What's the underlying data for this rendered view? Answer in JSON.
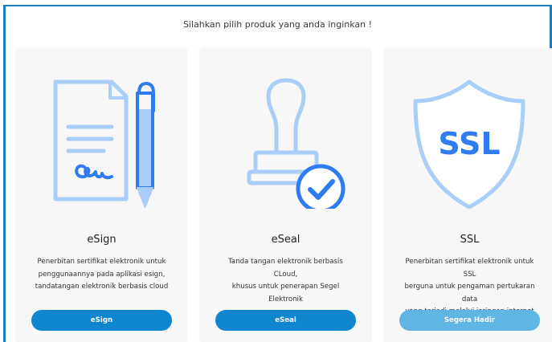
{
  "heading": "Silahkan pilih produk yang anda inginkan !",
  "colors": {
    "border": "#1a7fc1",
    "icon_light": "#a9cef9",
    "icon_dark": "#2f7cf0",
    "button_primary": "#0f86cf",
    "button_disabled": "#5fb5e4"
  },
  "cards": [
    {
      "icon": "esign-document-pen-icon",
      "title": "eSign",
      "desc_lines": [
        "Penerbitan sertifikat elektronik untuk",
        "penggunaannya pada aplikasi esign,",
        "tandatangan elektronik berbasis cloud"
      ],
      "button": "eSign"
    },
    {
      "icon": "eseal-stamp-check-icon",
      "title": "eSeal",
      "desc_lines": [
        "Tanda tangan elektronik berbasis CLoud,",
        "khusus untuk penerapan Segel Elektronik"
      ],
      "button": "eSeal"
    },
    {
      "icon": "ssl-shield-icon",
      "icon_text": "SSL",
      "title": "SSL",
      "desc_lines": [
        "Penerbitan sertifikat elektronik untuk SSL",
        "berguna untuk pengaman pertukaran data",
        "yang terjadi melalui jaringan internet"
      ],
      "button": "Segera Hadir"
    }
  ]
}
